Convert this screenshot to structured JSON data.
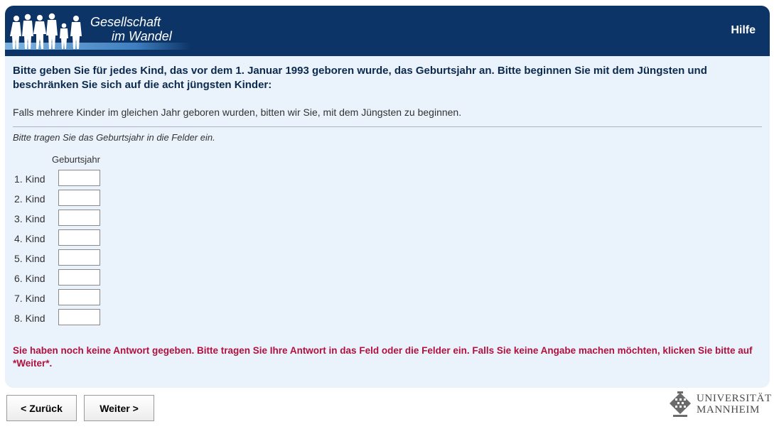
{
  "header": {
    "brand_line1": "Gesellschaft",
    "brand_line2": "im Wandel",
    "help_label": "Hilfe"
  },
  "question": {
    "text": "Bitte geben Sie für jedes Kind, das vor dem 1. Januar 1993 geboren wurde, das Geburtsjahr an. Bitte beginnen Sie mit dem Jüngsten und beschränken Sie sich auf die acht jüngsten Kinder:",
    "note": "Falls mehrere Kinder im gleichen Jahr geboren wurden, bitten wir Sie, mit dem Jüngsten zu beginnen.",
    "instruction": "Bitte tragen Sie das Geburtsjahr in die Felder ein."
  },
  "grid": {
    "column_header": "Geburtsjahr",
    "rows": [
      {
        "label": "1. Kind",
        "value": ""
      },
      {
        "label": "2. Kind",
        "value": ""
      },
      {
        "label": "3. Kind",
        "value": ""
      },
      {
        "label": "4. Kind",
        "value": ""
      },
      {
        "label": "5. Kind",
        "value": ""
      },
      {
        "label": "6. Kind",
        "value": ""
      },
      {
        "label": "7. Kind",
        "value": ""
      },
      {
        "label": "8. Kind",
        "value": ""
      }
    ]
  },
  "error": {
    "text": "Sie haben noch keine Antwort gegeben. Bitte tragen Sie Ihre Antwort in das Feld oder die Felder ein. Falls Sie keine Angabe machen möchten, klicken Sie bitte auf *Weiter*."
  },
  "navigation": {
    "back_label": "< Zurück",
    "next_label": "Weiter >"
  },
  "footer": {
    "university_line1": "UNIVERSITÄT",
    "university_line2": "MANNHEIM"
  },
  "colors": {
    "header_bg": "#0c3466",
    "panel_bg": "#eaf2fb",
    "error_text": "#b0113d",
    "question_text": "#0c2a4d"
  }
}
